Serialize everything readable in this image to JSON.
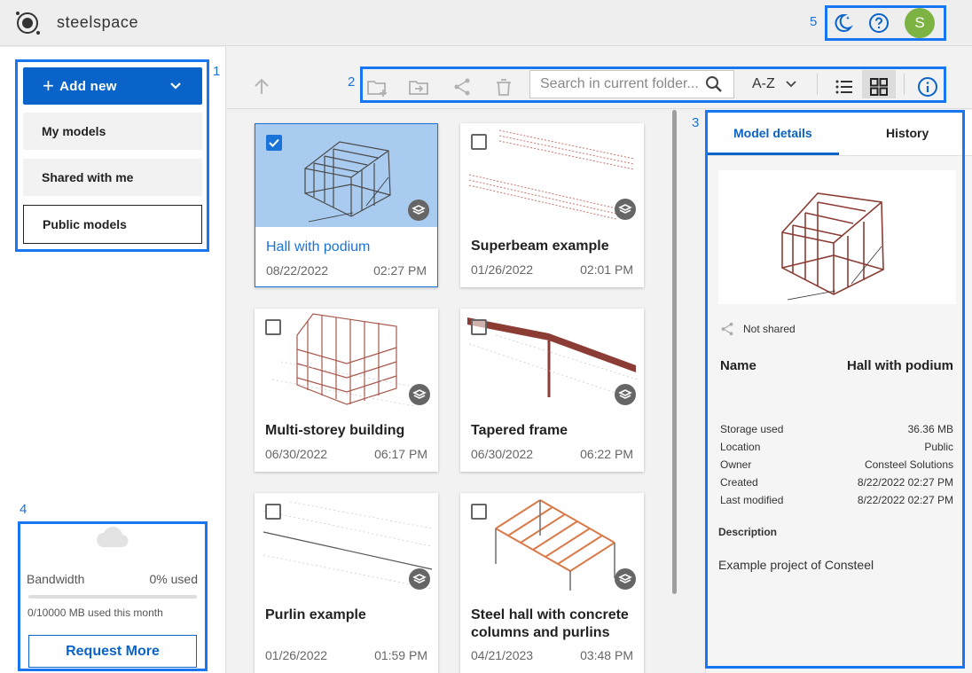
{
  "app": {
    "brand": "steelspace"
  },
  "annotations": {
    "a1": "1",
    "a2": "2",
    "a3": "3",
    "a4": "4",
    "a5": "5"
  },
  "header": {
    "avatar_initial": "S",
    "icons": [
      "dark-mode-icon",
      "help-icon"
    ]
  },
  "sidebar": {
    "add_new_label": "Add new",
    "items": [
      {
        "label": "My models"
      },
      {
        "label": "Shared with me"
      },
      {
        "label": "Public models",
        "active": true
      }
    ],
    "bandwidth": {
      "label": "Bandwidth",
      "used": "0% used",
      "used_fraction": 0,
      "detail": "0/10000 MB used this month",
      "request_label": "Request More"
    }
  },
  "toolbar": {
    "search_placeholder": "Search in current folder...",
    "sort_label": "A-Z",
    "icons": [
      "arrow-up-icon",
      "new-folder-icon",
      "move-to-folder-icon",
      "share-icon",
      "delete-icon",
      "search-icon",
      "list-view-icon",
      "grid-view-icon",
      "info-icon"
    ]
  },
  "models": [
    {
      "title": "Hall with podium",
      "date": "08/22/2022",
      "time": "02:27 PM",
      "selected": true
    },
    {
      "title": "Superbeam example",
      "date": "01/26/2022",
      "time": "02:01 PM",
      "selected": false
    },
    {
      "title": "Multi-storey building",
      "date": "06/30/2022",
      "time": "06:17 PM",
      "selected": false
    },
    {
      "title": "Tapered frame",
      "date": "06/30/2022",
      "time": "06:22 PM",
      "selected": false
    },
    {
      "title": "Purlin example",
      "date": "01/26/2022",
      "time": "01:59 PM",
      "selected": false
    },
    {
      "title": "Steel hall with concrete columns and purlins",
      "date": "04/21/2023",
      "time": "03:48 PM",
      "selected": false
    }
  ],
  "details": {
    "tabs": [
      "Model details",
      "History"
    ],
    "share_status": "Not shared",
    "name_label": "Name",
    "name_value": "Hall with podium",
    "rows": [
      {
        "label": "Storage used",
        "value": "36.36 MB"
      },
      {
        "label": "Location",
        "value": "Public"
      },
      {
        "label": "Owner",
        "value": "Consteel Solutions"
      },
      {
        "label": "Created",
        "value": "8/22/2022 02:27 PM"
      },
      {
        "label": "Last modified",
        "value": "8/22/2022 02:27 PM"
      }
    ],
    "description_label": "Description",
    "description": "Example project of Consteel"
  },
  "colors": {
    "primary": "#0a63c9",
    "selected_bg": "#aacbf0",
    "annotation": "#1976f2",
    "avatar": "#7cb342"
  }
}
